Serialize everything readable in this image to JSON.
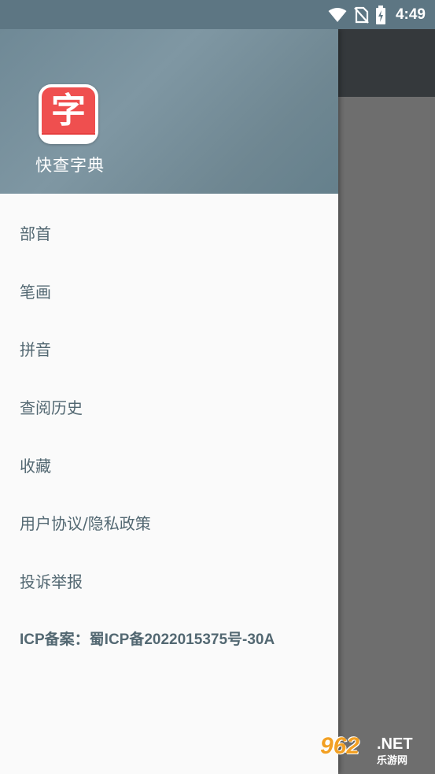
{
  "status_bar": {
    "time": "4:49",
    "icons": [
      "wifi-icon",
      "no-sim-icon",
      "battery-charging-icon"
    ]
  },
  "drawer": {
    "header": {
      "logo_char": "字",
      "app_name": "快查字典"
    },
    "menu": [
      {
        "label": "部首"
      },
      {
        "label": "笔画"
      },
      {
        "label": "拼音"
      },
      {
        "label": "查阅历史"
      },
      {
        "label": "收藏"
      },
      {
        "label": "用户协议/隐私政策"
      },
      {
        "label": "投诉举报"
      },
      {
        "label": "ICP备案：蜀ICP备2022015375号-30A"
      }
    ]
  },
  "watermark": {
    "number": "962",
    "domain": ".NET",
    "subtitle": "乐游网"
  },
  "colors": {
    "status_bar": "#5d7683",
    "header": "#7891a0",
    "menu_text": "#536872",
    "logo_red": "#ef4f4f",
    "scrim": "#6e6e6e"
  }
}
